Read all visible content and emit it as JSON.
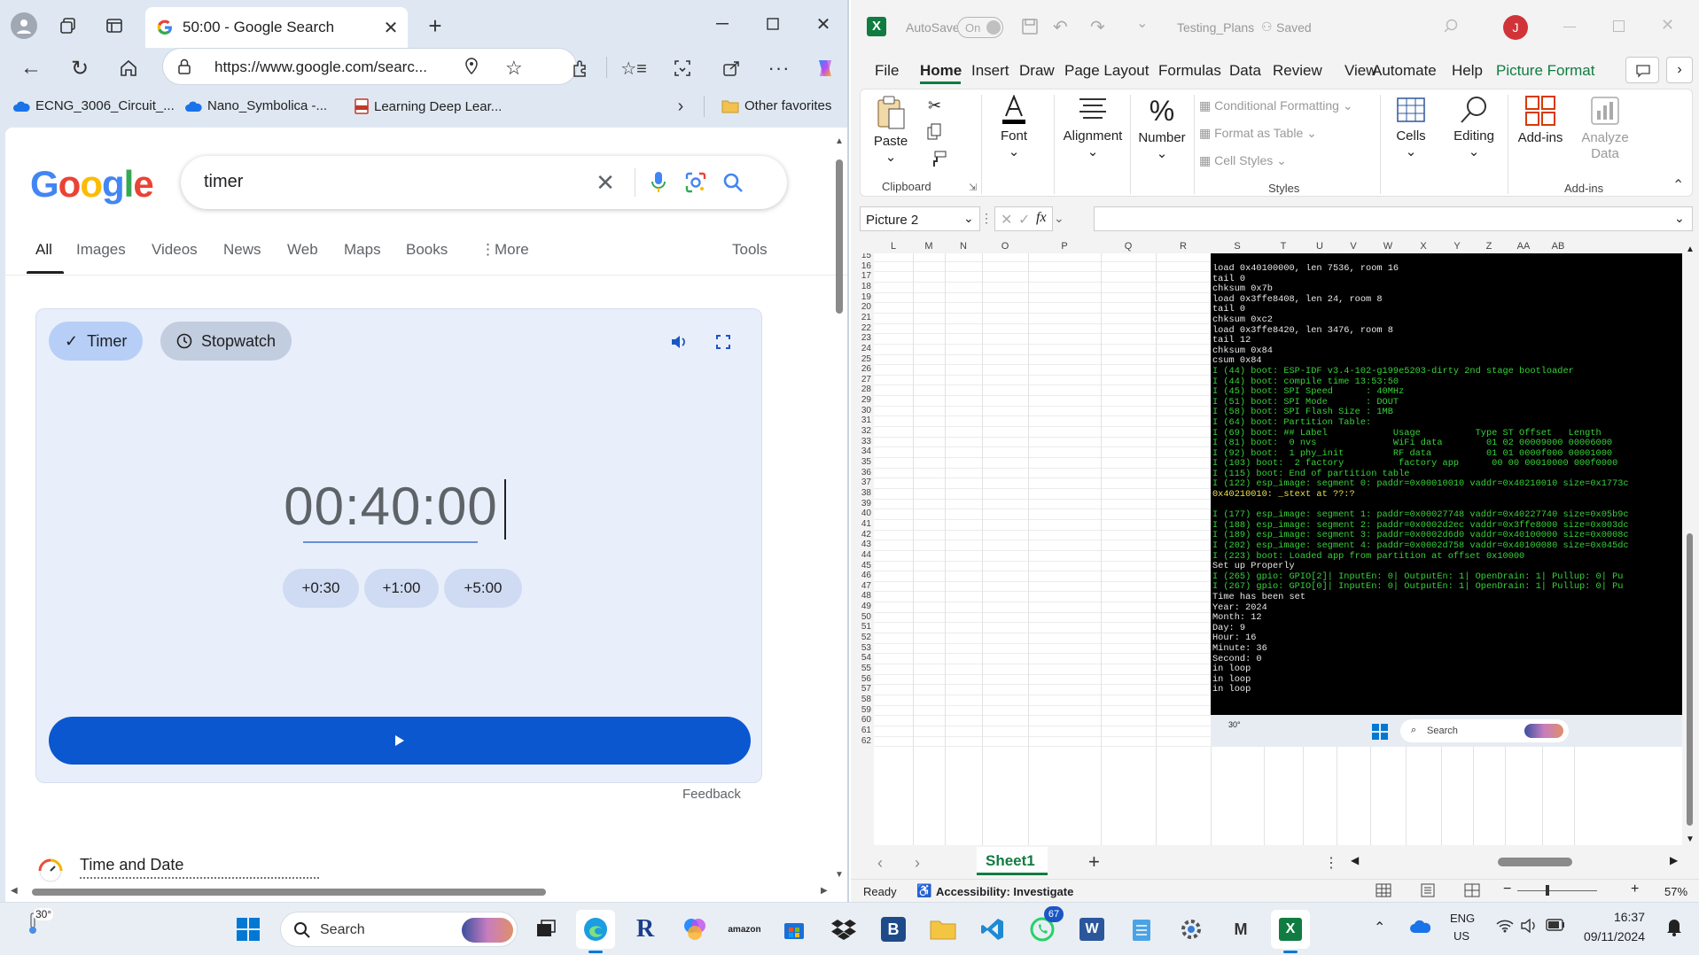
{
  "edge": {
    "tab_title": "50:00 - Google Search",
    "url": "https://www.google.com/searc...",
    "favorites": [
      "ECNG_3006_Circuit_...",
      "Nano_Symbolica -...",
      "Learning Deep Lear..."
    ],
    "other_favorites": "Other favorites",
    "google": {
      "search_query": "timer",
      "tabs": [
        "All",
        "Images",
        "Videos",
        "News",
        "Web",
        "Maps",
        "Books",
        "More"
      ],
      "tools": "Tools",
      "timer_tab": "Timer",
      "stopwatch_tab": "Stopwatch",
      "time_display": "00:40:00",
      "quick_add": [
        "+0:30",
        "+1:00",
        "+5:00"
      ],
      "feedback": "Feedback",
      "result_title": "Time and Date"
    }
  },
  "excel": {
    "autosave_label": "AutoSave",
    "autosave_state": "On",
    "file_name": "Testing_Plans",
    "save_status": "Saved",
    "user_initial": "J",
    "menu": [
      "File",
      "Home",
      "Insert",
      "Draw",
      "Page Layout",
      "Formulas",
      "Data",
      "Review",
      "View",
      "Automate",
      "Help",
      "Picture Format"
    ],
    "ribbon": {
      "paste": "Paste",
      "clipboard": "Clipboard",
      "font": "Font",
      "alignment": "Alignment",
      "number": "Number",
      "conditional_formatting": "Conditional Formatting",
      "format_as_table": "Format as Table",
      "cell_styles": "Cell Styles",
      "styles": "Styles",
      "cells": "Cells",
      "editing": "Editing",
      "addins": "Add-ins",
      "analyze_data": "Analyze Data",
      "addins_group": "Add-ins"
    },
    "name_box": "Picture 2",
    "formula_fx": "fx",
    "columns": [
      "L",
      "M",
      "N",
      "O",
      "P",
      "Q",
      "R",
      "S",
      "T",
      "U",
      "V",
      "W",
      "X",
      "Y",
      "Z",
      "AA",
      "AB"
    ],
    "row_start": 15,
    "row_end": 62,
    "terminal_lines": [
      {
        "t": "load 0x40100000, len 7536, room 16",
        "c": "w"
      },
      {
        "t": "tail 0",
        "c": "w"
      },
      {
        "t": "chksum 0x7b",
        "c": "w"
      },
      {
        "t": "load 0x3ffe8408, len 24, room 8",
        "c": "w"
      },
      {
        "t": "tail 0",
        "c": "w"
      },
      {
        "t": "chksum 0xc2",
        "c": "w"
      },
      {
        "t": "load 0x3ffe8420, len 3476, room 8",
        "c": "w"
      },
      {
        "t": "tail 12",
        "c": "w"
      },
      {
        "t": "chksum 0x84",
        "c": "w"
      },
      {
        "t": "csum 0x84",
        "c": "w"
      },
      {
        "t": "I (44) boot: ESP-IDF v3.4-102-g199e5203-dirty 2nd stage bootloader",
        "c": "g"
      },
      {
        "t": "I (44) boot: compile time 13:53:50",
        "c": "g"
      },
      {
        "t": "I (45) boot: SPI Speed      : 40MHz",
        "c": "g"
      },
      {
        "t": "I (51) boot: SPI Mode       : DOUT",
        "c": "g"
      },
      {
        "t": "I (58) boot: SPI Flash Size : 1MB",
        "c": "g"
      },
      {
        "t": "I (64) boot: Partition Table:",
        "c": "g"
      },
      {
        "t": "I (69) boot: ## Label            Usage          Type ST Offset   Length",
        "c": "g"
      },
      {
        "t": "I (81) boot:  0 nvs              WiFi data        01 02 00009000 00006000",
        "c": "g"
      },
      {
        "t": "I (92) boot:  1 phy_init         RF data          01 01 0000f000 00001000",
        "c": "g"
      },
      {
        "t": "I (103) boot:  2 factory          factory app      00 00 00010000 000f0000",
        "c": "g"
      },
      {
        "t": "I (115) boot: End of partition table",
        "c": "g"
      },
      {
        "t": "I (122) esp_image: segment 0: paddr=0x00010010 vaddr=0x40210010 size=0x1773c",
        "c": "g"
      },
      {
        "t": "0x40210010: _stext at ??:?",
        "c": "y"
      },
      {
        "t": "",
        "c": "w"
      },
      {
        "t": "I (177) esp_image: segment 1: paddr=0x00027748 vaddr=0x40227740 size=0x05b9c",
        "c": "g"
      },
      {
        "t": "I (188) esp_image: segment 2: paddr=0x0002d2ec vaddr=0x3ffe8000 size=0x003dc",
        "c": "g"
      },
      {
        "t": "I (189) esp_image: segment 3: paddr=0x0002d6d0 vaddr=0x40100000 size=0x0008c",
        "c": "g"
      },
      {
        "t": "I (202) esp_image: segment 4: paddr=0x0002d758 vaddr=0x40100080 size=0x045dc",
        "c": "g"
      },
      {
        "t": "I (223) boot: Loaded app from partition at offset 0x10000",
        "c": "g"
      },
      {
        "t": "Set up Properly",
        "c": "w"
      },
      {
        "t": "I (265) gpio: GPIO[2]| InputEn: 0| OutputEn: 1| OpenDrain: 1| Pullup: 0| Pu",
        "c": "g"
      },
      {
        "t": "I (267) gpio: GPIO[0]| InputEn: 0| OutputEn: 1| OpenDrain: 1| Pullup: 0| Pu",
        "c": "g"
      },
      {
        "t": "Time has been set",
        "c": "w"
      },
      {
        "t": "Year: 2024",
        "c": "w"
      },
      {
        "t": "Month: 12",
        "c": "w"
      },
      {
        "t": "Day: 9",
        "c": "w"
      },
      {
        "t": "Hour: 16",
        "c": "w"
      },
      {
        "t": "Minute: 36",
        "c": "w"
      },
      {
        "t": "Second: 0",
        "c": "w"
      },
      {
        "t": "in loop",
        "c": "w"
      },
      {
        "t": "in loop",
        "c": "w"
      },
      {
        "t": "in loop",
        "c": "w"
      }
    ],
    "mini_taskbar_temp": "30°",
    "mini_taskbar_search": "Search",
    "sheet_tab": "Sheet1",
    "status": "Ready",
    "accessibility": "Accessibility: Investigate",
    "zoom": "57%"
  },
  "taskbar": {
    "weather_temp": "30°",
    "search_placeholder": "Search",
    "whatsapp_badge": "67",
    "language": "ENG",
    "region": "US",
    "time": "16:37",
    "date": "09/11/2024"
  }
}
